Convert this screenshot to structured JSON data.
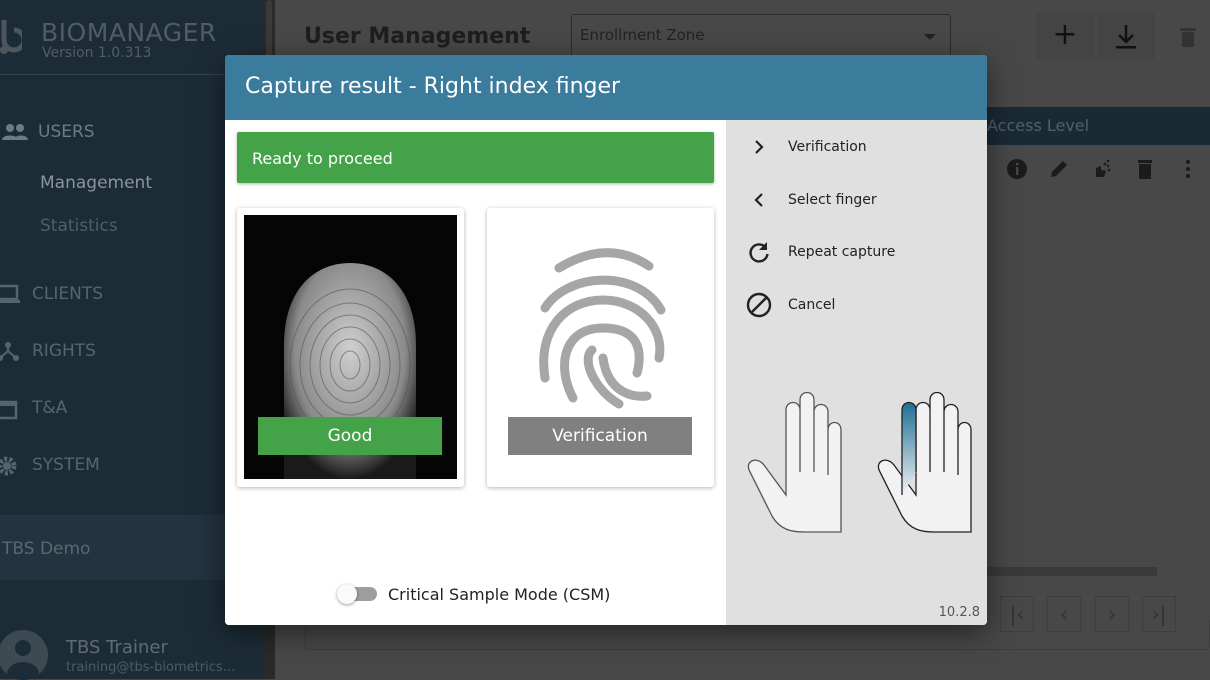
{
  "sidebar": {
    "brand": "BIOMANAGER",
    "version": "Version 1.0.313",
    "items": [
      {
        "label": "USERS",
        "icon": "users-icon"
      },
      {
        "label": "CLIENTS",
        "icon": "monitor-icon"
      },
      {
        "label": "RIGHTS",
        "icon": "share-icon"
      },
      {
        "label": "T&A",
        "icon": "calendar-icon"
      },
      {
        "label": "SYSTEM",
        "icon": "gear-icon"
      }
    ],
    "sub_items": [
      "Management",
      "Statistics"
    ],
    "tenant": "TBS Demo",
    "user": {
      "name": "TBS Trainer",
      "email": "training@tbs-biometrics..."
    }
  },
  "main": {
    "title": "User Management",
    "zone": "Enrollment Zone",
    "table_header": "Access Level",
    "pagination": [
      "first",
      "previous",
      "next",
      "last"
    ]
  },
  "modal": {
    "title": "Capture result - Right index finger",
    "status": "Ready to proceed",
    "capture_label": "Good",
    "verification_label": "Verification",
    "csm_label": "Critical Sample Mode (CSM)",
    "csm_enabled": false,
    "actions": [
      {
        "label": "Verification",
        "icon": "chevron-right-icon"
      },
      {
        "label": "Select finger",
        "icon": "chevron-left-icon"
      },
      {
        "label": "Repeat capture",
        "icon": "refresh-icon"
      },
      {
        "label": "Cancel",
        "icon": "block-icon"
      }
    ],
    "selected_finger": "right index",
    "version": "10.2.8"
  },
  "colors": {
    "header": "#3b7b9b",
    "success": "#44a248",
    "neutral": "#808080"
  }
}
